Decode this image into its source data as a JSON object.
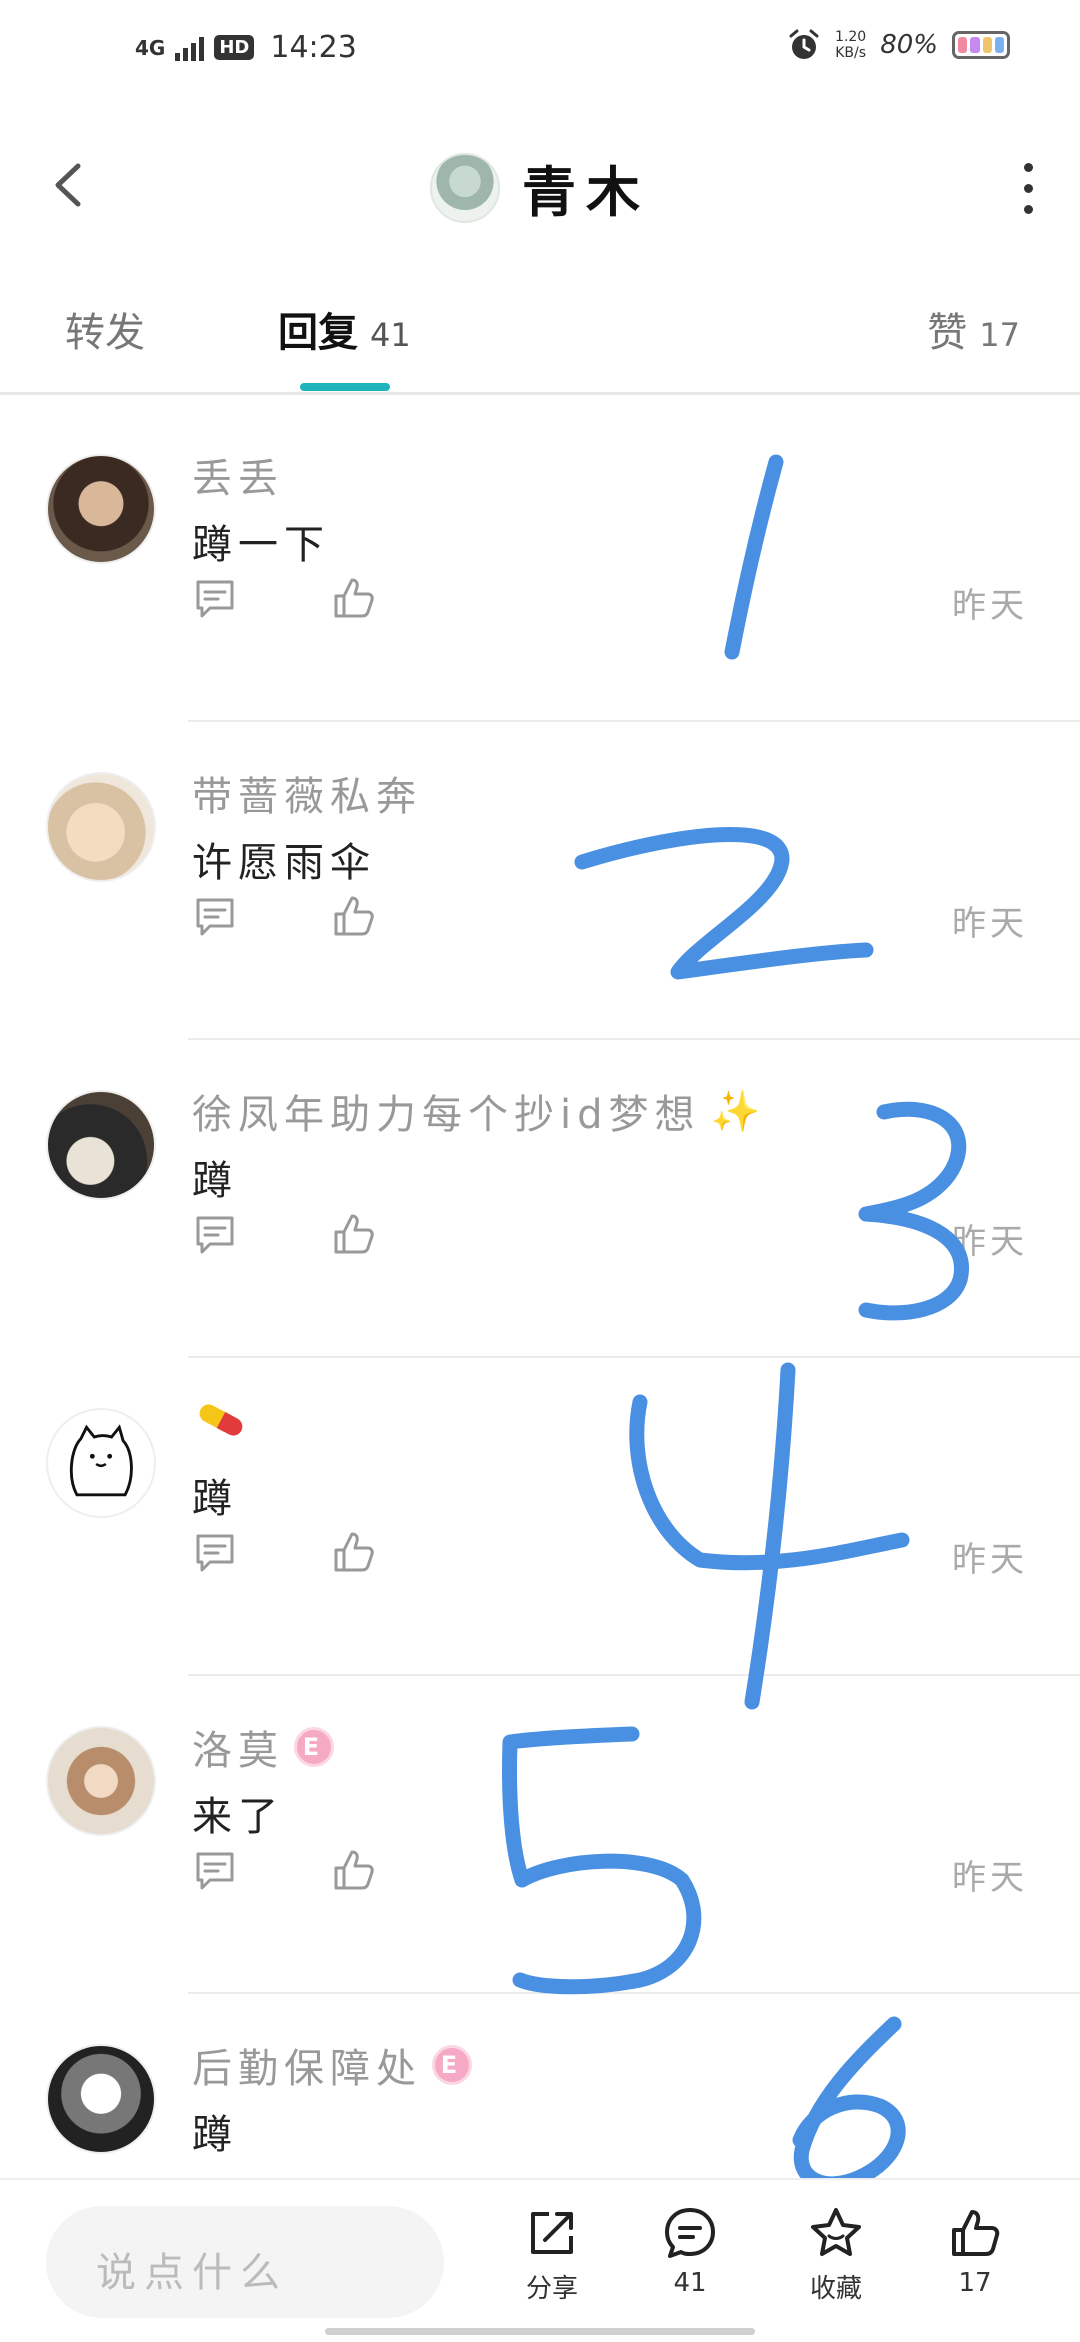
{
  "status": {
    "network": "4G",
    "hd": "HD",
    "time": "14:23",
    "speed_value": "1.20",
    "speed_unit": "KB/s",
    "battery": "80%"
  },
  "header": {
    "title": "青木"
  },
  "tabs": {
    "repost_label": "转发",
    "reply_label": "回复",
    "reply_count": "41",
    "like_label": "赞",
    "like_count": "17"
  },
  "comments": [
    {
      "name": "丢丢",
      "text": "蹲一下",
      "time": "昨天"
    },
    {
      "name": "带蔷薇私奔",
      "text": "许愿雨伞",
      "time": "昨天"
    },
    {
      "name": "徐凤年助力每个抄id梦想",
      "text": "蹲",
      "time": "昨天"
    },
    {
      "name": "",
      "text": "蹲",
      "time": "昨天"
    },
    {
      "name": "洛莫",
      "text": "来了",
      "time": "昨天",
      "badge": "E"
    },
    {
      "name": "后勤保障处",
      "text": "蹲",
      "badge": "E"
    }
  ],
  "handwritten_numbers": [
    "1",
    "2",
    "3",
    "4",
    "5",
    "6"
  ],
  "bottom": {
    "input_placeholder": "说点什么",
    "share_label": "分享",
    "comment_count": "41",
    "favorite_label": "收藏",
    "like_count": "17"
  },
  "colors": {
    "accent_teal": "#1fb4bd",
    "handwriting_blue": "#4a90e2",
    "badge_pink": "#f6a9c5"
  }
}
